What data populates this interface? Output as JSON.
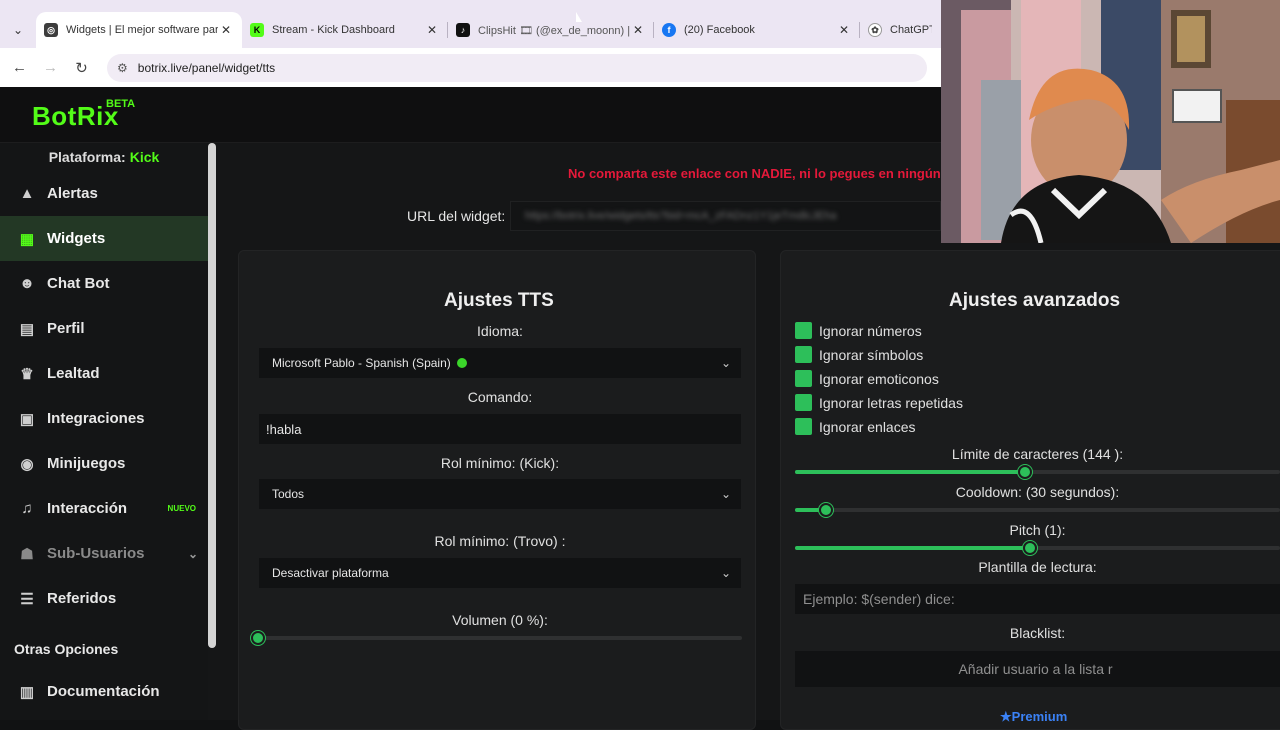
{
  "browser": {
    "tabs": [
      {
        "title": "Widgets | El mejor software par",
        "favicon": "botrix-icon",
        "color": "#3d3d3d",
        "active": true
      },
      {
        "title": "Stream - Kick Dashboard",
        "favicon": "kick-icon",
        "color": "#53fc18",
        "active": false
      },
      {
        "title": "ClipsHit 🎞 (@ex_de_moonn) | Ti",
        "favicon": "tiktok-icon",
        "color": "#111111",
        "active": false
      },
      {
        "title": "(20) Facebook",
        "favicon": "facebook-icon",
        "color": "#1877f2",
        "active": false
      },
      {
        "title": "ChatGPT",
        "favicon": "chatgpt-icon",
        "color": "#444444",
        "active": false
      }
    ],
    "url": "botrix.live/panel/widget/tts"
  },
  "app": {
    "logo": "BotRix",
    "beta": "BETA",
    "platform_label": "Plataforma:",
    "platform_value": "Kick",
    "accent": "#53fc18"
  },
  "sidebar": {
    "items": [
      {
        "label": "Alertas",
        "icon": "warning-icon"
      },
      {
        "label": "Widgets",
        "icon": "grid-icon"
      },
      {
        "label": "Chat Bot",
        "icon": "robot-icon"
      },
      {
        "label": "Perfil",
        "icon": "id-card-icon"
      },
      {
        "label": "Lealtad",
        "icon": "trophy-icon"
      },
      {
        "label": "Integraciones",
        "icon": "integrations-icon"
      },
      {
        "label": "Minijuegos",
        "icon": "gamepad-icon"
      },
      {
        "label": "Interacción",
        "icon": "music-icon",
        "badge": "NUEVO"
      },
      {
        "label": "Sub-Usuarios",
        "icon": "users-icon"
      },
      {
        "label": "Referidos",
        "icon": "referrals-icon"
      }
    ],
    "section_title": "Otras Opciones",
    "extra_items": [
      {
        "label": "Documentación",
        "icon": "book-icon"
      }
    ]
  },
  "main": {
    "warning": "No comparta este enlace con NADIE, ni lo pegues en ningún",
    "url_label": "URL del widget:",
    "url_value": "https://botrix.live/widgets/tts?bid=mcA_zFADnz1Y1jeTmdlcJEha"
  },
  "tts": {
    "title": "Ajustes TTS",
    "idioma_label": "Idioma:",
    "idioma_value": "Microsoft Pablo - Spanish (Spain)",
    "comando_label": "Comando:",
    "comando_value": "!habla",
    "rol_kick_label": "Rol mínimo: (Kick):",
    "rol_kick_value": "Todos",
    "rol_trovo_label": "Rol mínimo: (Trovo) :",
    "rol_trovo_value": "Desactivar plataforma",
    "volumen_label": "Volumen (0 %):",
    "volumen_value": 0
  },
  "advanced": {
    "title": "Ajustes avanzados",
    "checks": [
      "Ignorar números",
      "Ignorar símbolos",
      "Ignorar emoticonos",
      "Ignorar letras repetidas",
      "Ignorar enlaces"
    ],
    "limit_label": "Límite de caracteres (144 ):",
    "limit_fraction": 0.46,
    "cooldown_label": "Cooldown: (30 segundos):",
    "cooldown_fraction": 0.05,
    "pitch_label": "Pitch (1):",
    "pitch_fraction": 0.47,
    "plantilla_label": "Plantilla de lectura:",
    "plantilla_placeholder": "Ejemplo: $(sender) dice:",
    "blacklist_label": "Blacklist:",
    "blacklist_placeholder": "Añadir usuario a la lista r",
    "premium": "Premium"
  }
}
